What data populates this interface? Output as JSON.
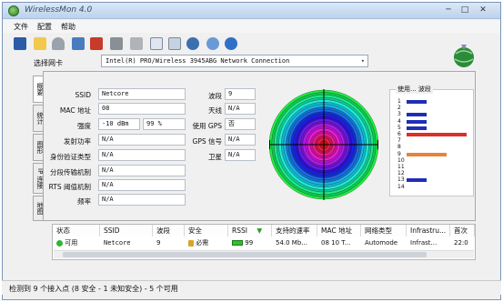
{
  "window": {
    "title": "WirelessMon 4.0",
    "minimize_glyph": "─",
    "maximize_glyph": "□",
    "close_glyph": "✕"
  },
  "menu": [
    "文件",
    "配置",
    "帮助"
  ],
  "toolbar": {
    "icons": [
      "save-icon",
      "open-folder-icon",
      "speed-icon",
      "network-icon",
      "disconnect-icon",
      "tools-icon",
      "print-icon",
      "checklist-icon",
      "report-icon",
      "web-icon",
      "info-icon",
      "help-icon"
    ]
  },
  "adapter": {
    "label": "选择网卡",
    "value": "Intel(R) PRO/Wireless 3945ABG Network Connection",
    "dropdown": "▾"
  },
  "tabs": [
    "概要",
    "统计",
    "图形",
    "IP 连接",
    "地图"
  ],
  "summary": {
    "ssid_label": "SSID",
    "ssid": "Netcore",
    "mac_label": "MAC 地址",
    "mac": "08",
    "strength_label": "强度",
    "strength_dbm": "-10 dBm",
    "strength_pct": "99 %",
    "tx_label": "发射功率",
    "tx": "N/A",
    "auth_label": "身份验证类型",
    "auth": "N/A",
    "frag_label": "分段传输机制",
    "frag": "N/A",
    "rts_label": "RTS 阈值机制",
    "rts": "N/A",
    "freq_label": "频率",
    "freq": "N/A",
    "channel_label": "波段",
    "channel": "9",
    "antenna_label": "天线",
    "antenna": "N/A",
    "gps_label": "使用 GPS",
    "gps": "否",
    "gps_signal_label": "GPS 信号",
    "gps_signal": "N/A",
    "satellite_label": "卫星",
    "satellite": "N/A"
  },
  "usage": {
    "title": "使用... 波段",
    "channels": [
      "1",
      "2",
      "3",
      "4",
      "5",
      "6",
      "7",
      "8",
      "9",
      "10",
      "11",
      "12",
      "13",
      "14"
    ],
    "values": [
      1,
      0,
      1,
      1,
      1,
      3,
      0,
      0,
      2,
      0,
      0,
      0,
      1,
      0
    ],
    "colors": {
      "normal": "#1f2db8",
      "highlight": "#d9302a",
      "current": "#e8843a"
    }
  },
  "list": {
    "headers": [
      "状态",
      "SSID",
      "波段",
      "安全",
      "RSSI",
      "支持的速率",
      "MAC 地址",
      "网络类型",
      "Infrastru...",
      "首次"
    ],
    "sort_indicator": "▼",
    "rows": [
      {
        "status": "可用",
        "ssid": "Netcore",
        "channel": "9",
        "security": "必需",
        "rssi": "99",
        "rates": "54.0 Mb...",
        "mac": "08 10 T...",
        "net_type": "Automode",
        "infra": "Infrast...",
        "first": "22:0"
      }
    ]
  },
  "status": {
    "text": "检测到 9 个接入点 (8 安全 - 1 未知安全) - 5 个可用"
  }
}
